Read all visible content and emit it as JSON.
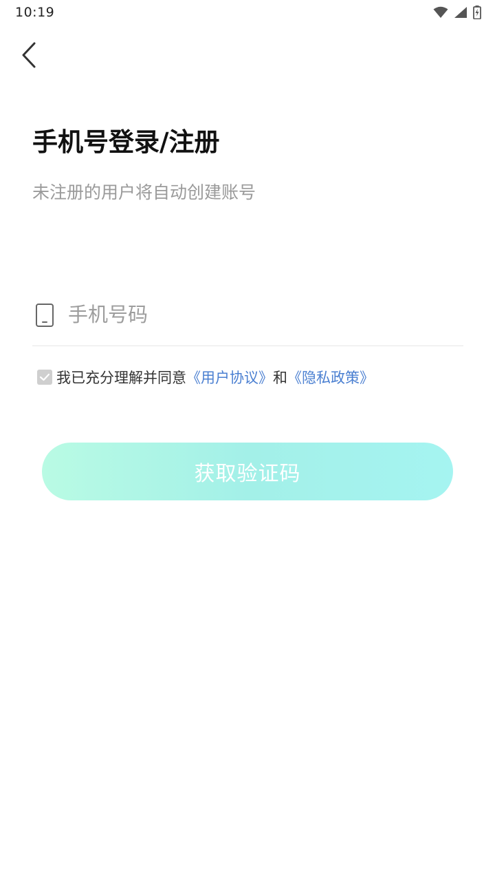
{
  "status_bar": {
    "time": "10:19",
    "icons": [
      "wifi-icon",
      "signal-icon",
      "battery-charging-icon"
    ]
  },
  "header": {
    "back_icon": "chevron-left-icon"
  },
  "title": "手机号登录/注册",
  "subtitle": "未注册的用户将自动创建账号",
  "phone_input": {
    "icon": "phone-icon",
    "value": "",
    "placeholder": "手机号码"
  },
  "agreement": {
    "checked": true,
    "prefix": "我已充分理解并同意",
    "user_agreement": "《用户协议》",
    "conjunction": "和",
    "privacy_policy": "《隐私政策》"
  },
  "submit_button": {
    "label": "获取验证码",
    "enabled": false
  },
  "colors": {
    "link": "#4a7fd1",
    "button_gradient_start": "#b9fbe4",
    "button_gradient_end": "#a5f4f1",
    "checkbox": "#cfcfcf"
  }
}
